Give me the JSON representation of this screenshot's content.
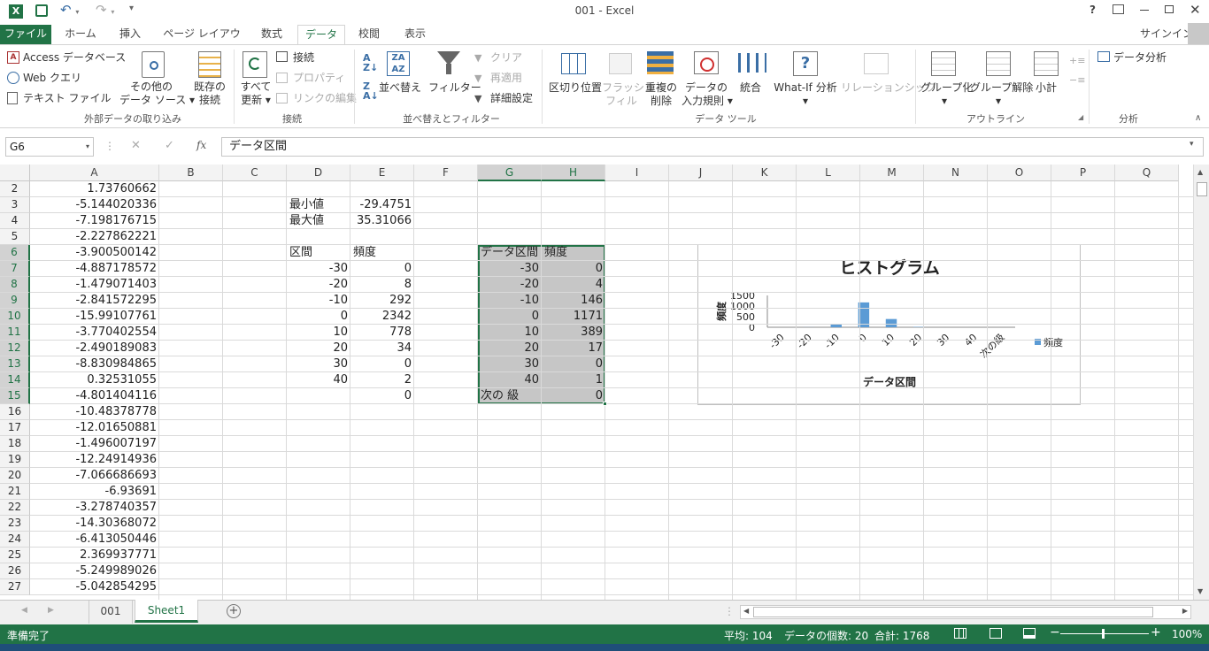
{
  "titlebar": {
    "title": "001 - Excel",
    "help": "?",
    "signin": "サインイン"
  },
  "tabs": [
    {
      "label": "ファイル"
    },
    {
      "label": "ホーム"
    },
    {
      "label": "挿入"
    },
    {
      "label": "ページ レイアウト"
    },
    {
      "label": "数式"
    },
    {
      "label": "データ"
    },
    {
      "label": "校閲"
    },
    {
      "label": "表示"
    }
  ],
  "ribbon": {
    "ext": {
      "access": "Access データベース",
      "web": "Web クエリ",
      "text": "テキスト ファイル",
      "other1": "その他の",
      "other2": "データ ソース",
      "existing1": "既存の",
      "existing2": "接続",
      "group": "外部データの取り込み"
    },
    "conn": {
      "refresh1": "すべて",
      "refresh2": "更新",
      "connections": "接続",
      "properties": "プロパティ",
      "edit_links": "リンクの編集",
      "group": "接続"
    },
    "sort": {
      "sort": "並べ替え",
      "filter": "フィルター",
      "clear": "クリア",
      "reapply": "再適用",
      "advanced": "詳細設定",
      "group": "並べ替えとフィルター"
    },
    "tools": {
      "t2c": "区切り位置",
      "flash1": "フラッシュ",
      "flash2": "フィル",
      "dup1": "重複の",
      "dup2": "削除",
      "val1": "データの",
      "val2": "入力規則",
      "consolidate": "統合",
      "whatif": "What-If 分析",
      "relations": "リレーションシップ",
      "group": "データ ツール"
    },
    "outline": {
      "group_btn": "グループ化",
      "ungroup": "グループ解除",
      "subtotal": "小計",
      "group": "アウトライン"
    },
    "analysis": {
      "btn": "データ分析",
      "group": "分析"
    }
  },
  "formula": {
    "namebox": "G6",
    "fx": "fx",
    "content": "データ区間"
  },
  "columns": [
    "A",
    "B",
    "C",
    "D",
    "E",
    "F",
    "G",
    "H",
    "I",
    "J",
    "K",
    "L",
    "M",
    "N",
    "O",
    "P",
    "Q"
  ],
  "rows": [
    "2",
    "3",
    "4",
    "5",
    "6",
    "7",
    "8",
    "9",
    "10",
    "11",
    "12",
    "13",
    "14",
    "15",
    "16",
    "17",
    "18",
    "19",
    "20",
    "21",
    "22",
    "23",
    "24",
    "25",
    "26",
    "27"
  ],
  "colA": [
    "1.73760662",
    "-5.144020336",
    "-7.198176715",
    "-2.227862221",
    "-3.900500142",
    "-4.887178572",
    "-1.479071403",
    "-2.841572295",
    "-15.99107761",
    "-3.770402554",
    "-2.490189083",
    "-8.830984865",
    "0.32531055",
    "-4.801404116",
    "-10.48378778",
    "-12.01650881",
    "-1.496007197",
    "-12.24914936",
    "-7.066686693",
    "-6.93691",
    "-3.278740357",
    "-14.30368072",
    "-6.413050446",
    "2.369937771",
    "-5.249989026",
    "-5.042854295"
  ],
  "stats": {
    "min_label": "最小値",
    "min_value": "-29.4751",
    "max_label": "最大値",
    "max_value": "35.31066"
  },
  "table1": {
    "h1": "区間",
    "h2": "頻度",
    "bins": [
      "-30",
      "-20",
      "-10",
      "0",
      "10",
      "20",
      "30",
      "40",
      ""
    ],
    "freq": [
      "0",
      "8",
      "292",
      "2342",
      "778",
      "34",
      "0",
      "2",
      "0"
    ]
  },
  "table2": {
    "h1": "データ区間",
    "h2": "頻度",
    "bins": [
      "-30",
      "-20",
      "-10",
      "0",
      "10",
      "20",
      "30",
      "40",
      "次の 級"
    ],
    "freq": [
      "0",
      "4",
      "146",
      "1171",
      "389",
      "17",
      "0",
      "1",
      "0"
    ]
  },
  "chart_data": {
    "type": "bar",
    "title": "ヒストグラム",
    "xlabel": "データ区間",
    "ylabel": "頻度",
    "categories": [
      "-30",
      "-20",
      "-10",
      "0",
      "10",
      "20",
      "30",
      "40",
      "次の級"
    ],
    "series": [
      {
        "name": "頻度",
        "values": [
          0,
          4,
          146,
          1171,
          389,
          17,
          0,
          1,
          0
        ],
        "color": "#5b9bd5"
      }
    ],
    "ylim": [
      0,
      1500
    ],
    "yticks": [
      "1500",
      "1000",
      "500",
      "0"
    ],
    "legend": "right"
  },
  "sheets": {
    "tab1": "001",
    "tab2": "Sheet1"
  },
  "status": {
    "ready": "準備完了",
    "avg": "平均: 104",
    "count": "データの個数: 20",
    "sum": "合計: 1768",
    "zoom": "100%"
  },
  "colors": {
    "accent": "#217346",
    "selection": "#c6c6c6"
  }
}
